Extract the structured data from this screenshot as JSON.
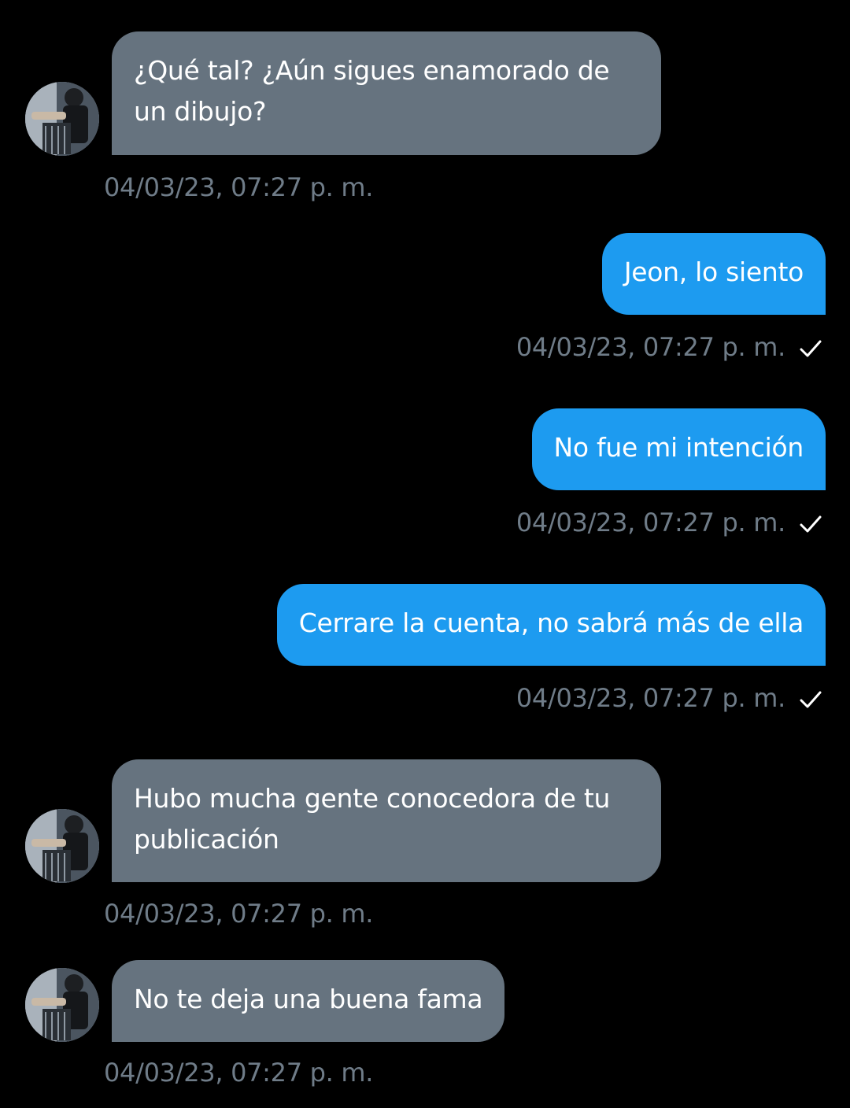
{
  "messages": [
    {
      "direction": "in",
      "text": "¿Qué tal? ¿Aún sigues enamorado de un dibujo?",
      "timestamp": "04/03/23, 07:27 p. m."
    },
    {
      "direction": "out",
      "text": "Jeon, lo siento",
      "timestamp": "04/03/23, 07:27 p. m.",
      "status": "sent"
    },
    {
      "direction": "out",
      "text": "No fue mi intención",
      "timestamp": "04/03/23, 07:27 p. m.",
      "status": "sent"
    },
    {
      "direction": "out",
      "text": "Cerrare la cuenta, no sabrá más de ella",
      "timestamp": "04/03/23, 07:27 p. m.",
      "status": "sent"
    },
    {
      "direction": "in",
      "text": "Hubo mucha gente conocedora de tu publicación",
      "timestamp": "04/03/23, 07:27 p. m."
    },
    {
      "direction": "in",
      "text": "No te deja una buena fama",
      "timestamp": "04/03/23, 07:27 p. m."
    }
  ],
  "icons": {
    "sent_status": "checkmark-icon",
    "contact_avatar": "avatar"
  },
  "colors": {
    "background": "#000000",
    "incoming_bubble": "#66737f",
    "outgoing_bubble": "#1d9bf0",
    "timestamp": "#6f7c88",
    "message_text": "#ffffff"
  }
}
